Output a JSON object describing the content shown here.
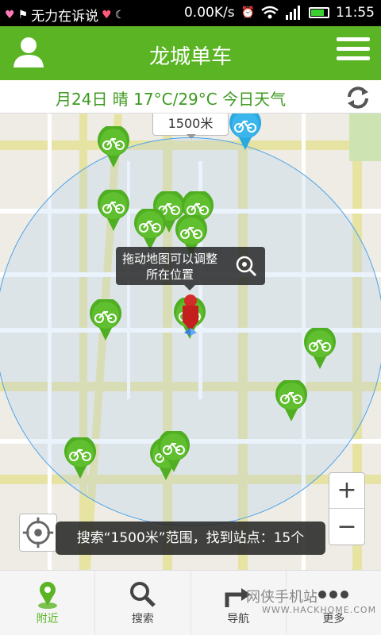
{
  "status_bar": {
    "left_text": "无力在诉说",
    "speed": "0.00K/s",
    "time": "11:55"
  },
  "header": {
    "title": "龙城单车"
  },
  "weather": {
    "text": "月24日 晴 17°C/29°C 今日天气"
  },
  "map": {
    "radius_label": "1500米",
    "tooltip_line1": "拖动地图可以调整",
    "tooltip_line2": "所在位置",
    "zoom_in": "+",
    "zoom_out": "−",
    "result_toast": "搜索“1500米”范围，找到站点：15个"
  },
  "nav": {
    "items": [
      {
        "label": "附近",
        "icon": "location-pin-icon"
      },
      {
        "label": "搜索",
        "icon": "search-icon"
      },
      {
        "label": "导航",
        "icon": "navigation-icon"
      },
      {
        "label": "更多",
        "icon": "more-icon"
      }
    ]
  },
  "watermark": {
    "text": "网侠手机站",
    "url": "WWW.HACKHOME.COM"
  },
  "colors": {
    "brand_green": "#5ab424",
    "station_green": "#4fae22",
    "selected_station_blue": "#2aa8e0",
    "user_marker_red": "#d52a2a"
  }
}
